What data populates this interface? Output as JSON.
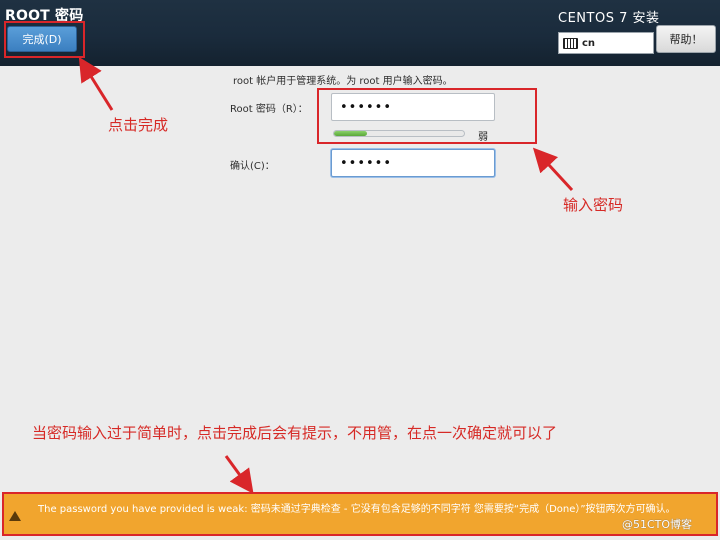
{
  "header": {
    "title": "ROOT 密码",
    "done_label": "完成(D)",
    "product": "CENTOS 7 安装",
    "keyboard_layout": "cn",
    "help_label": "帮助！"
  },
  "form": {
    "intro": "root 帐户用于管理系统。为 root 用户输入密码。",
    "root_password_label": "Root 密码（R）：",
    "root_password_value": "••••••",
    "confirm_label": "确认(C)：",
    "confirm_value": "••••••",
    "strength_text": "弱",
    "strength_fraction": 0.25
  },
  "annotations": {
    "click_done": "点击完成",
    "enter_password": "输入密码",
    "note": "当密码输入过于简单时，点击完成后会有提示，不用管，在点一次确定就可以了"
  },
  "warning": {
    "text": "The password you have provided is weak: 密码未通过字典检查 - 它没有包含足够的不同字符 您需要按“完成（Done）”按钮两次方可确认。"
  },
  "watermark": "@51CTO博客",
  "colors": {
    "header_bg": "#1a2b3c",
    "accent": "#3b7fc0",
    "warning_bg": "#f1a52e",
    "annotation": "#d9262a",
    "strength": "#5aa838"
  }
}
